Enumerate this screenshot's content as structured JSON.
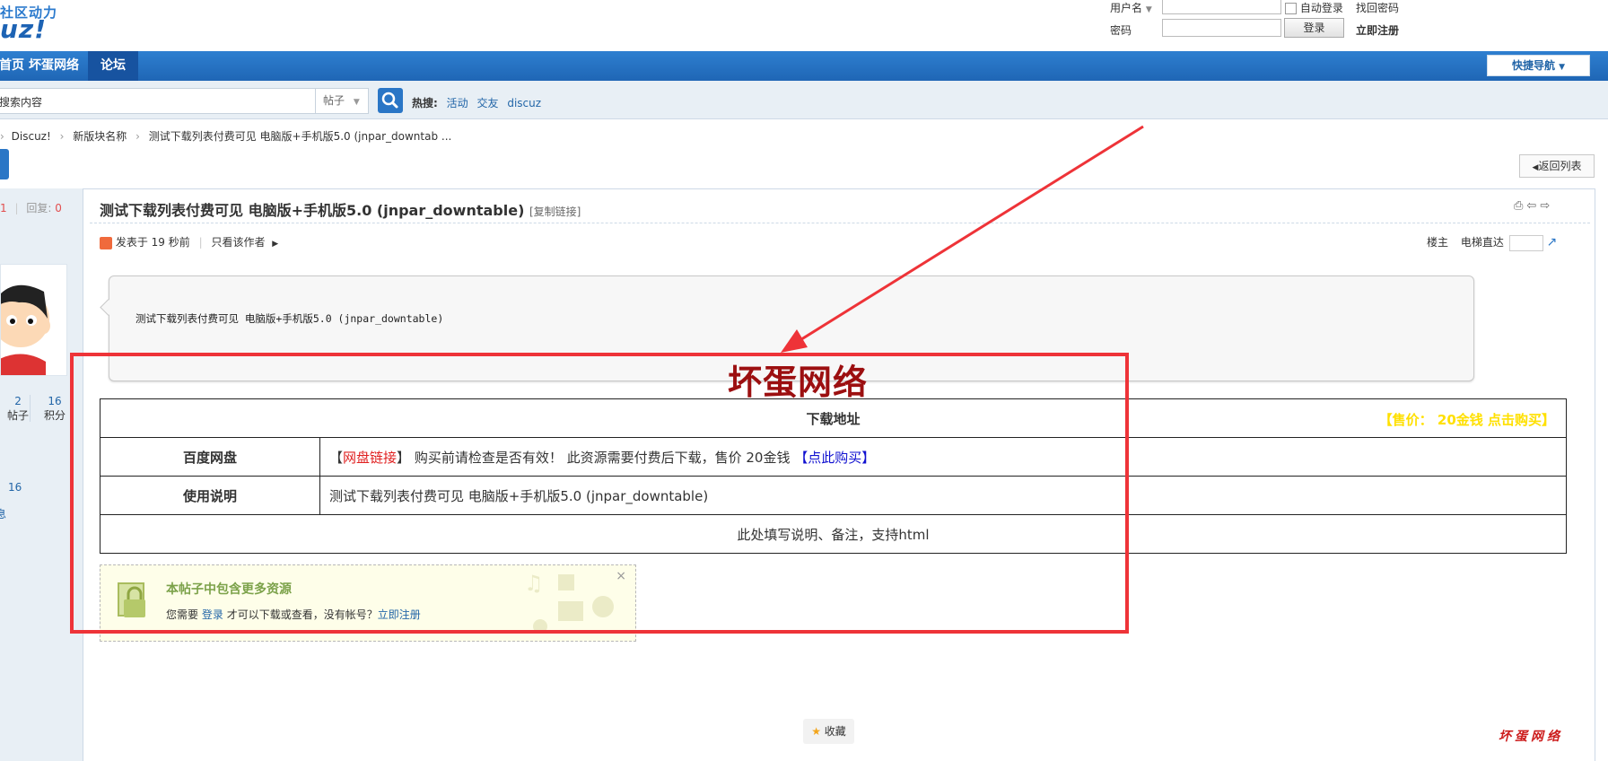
{
  "header": {
    "logo_top": "社区动力",
    "logo_main": "uz!",
    "username_label": "用户名",
    "password_label": "密码",
    "auto_login": "自动登录",
    "find_password": "找回密码",
    "register": "立即注册",
    "login_button": "登录"
  },
  "nav": {
    "items": [
      {
        "label": "首页"
      },
      {
        "label": "坏蛋网络"
      },
      {
        "label": "论坛"
      }
    ],
    "quick_nav": "快捷导航"
  },
  "search": {
    "placeholder": "搜索内容",
    "type": "帖子",
    "hot_label": "热搜:",
    "hot_tags": [
      "活动",
      "交友",
      "discuz"
    ]
  },
  "breadcrumb": {
    "items": [
      "Discuz!",
      "新版块名称",
      "测试下载列表付费可见 电脑版+手机版5.0 (jnpar_downtab ..."
    ]
  },
  "thread": {
    "back_list": "返回列表",
    "stat_view": "1",
    "stat_reply_label": "回复:",
    "stat_reply": "0",
    "title": "测试下载列表付费可见 电脑版+手机版5.0 (jnpar_downtable)",
    "copy_link": "[复制链接]",
    "posted": "发表于 19 秒前",
    "author_only": "只看该作者",
    "floor_owner": "楼主",
    "elevator": "电梯直达"
  },
  "user": {
    "posts_num": "2",
    "posts_label": "帖子",
    "score_num": "16",
    "score_label": "积分",
    "extra_num": "16",
    "extra_label": "息"
  },
  "post": {
    "body_text": "测试下载列表付费可见 电脑版+手机版5.0 (jnpar_downtable)",
    "brand": "坏蛋网络"
  },
  "download_table": {
    "header": "下载地址",
    "price_tag": "【售价： 20金钱 点击购买】",
    "rows": [
      {
        "label": "百度网盘",
        "bracket_open": "【",
        "link": "网盘链接",
        "bracket_close": "】",
        "text": "购买前请检查是否有效！ 此资源需要付费后下载，售价 20金钱",
        "buy": "【点此购买】"
      },
      {
        "label": "使用说明",
        "text": "测试下载列表付费可见 电脑版+手机版5.0 (jnpar_downtable)"
      }
    ],
    "footer": "此处填写说明、备注，支持html"
  },
  "resource": {
    "title": "本帖子中包含更多资源",
    "need": "您需要",
    "login": "登录",
    "middle": "才可以下载或查看，没有帐号？",
    "register": "立即注册",
    "close": "×"
  },
  "footer": {
    "favorite": "收藏",
    "watermark": "坏蛋网络"
  }
}
